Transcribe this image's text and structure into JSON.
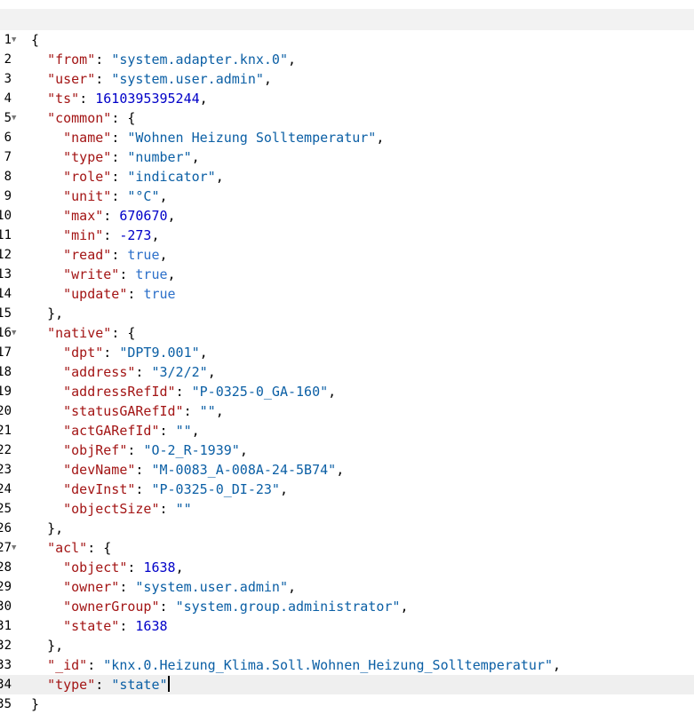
{
  "colors": {
    "key": "#a31515",
    "string": "#0b5fa5",
    "number": "#0000c8",
    "boolean": "#2b6fc9",
    "active_line": "#efefef",
    "topbar": "#f2f2f2"
  },
  "editor": {
    "lines": [
      {
        "num": "1",
        "fold": true,
        "indent": 0,
        "tokens": [
          {
            "t": "p",
            "v": "{"
          }
        ]
      },
      {
        "num": "2",
        "indent": 1,
        "tokens": [
          {
            "t": "k",
            "v": "\"from\""
          },
          {
            "t": "p",
            "v": ": "
          },
          {
            "t": "str",
            "v": "\"system.adapter.knx.0\""
          },
          {
            "t": "p",
            "v": ","
          }
        ]
      },
      {
        "num": "3",
        "indent": 1,
        "tokens": [
          {
            "t": "k",
            "v": "\"user\""
          },
          {
            "t": "p",
            "v": ": "
          },
          {
            "t": "str",
            "v": "\"system.user.admin\""
          },
          {
            "t": "p",
            "v": ","
          }
        ]
      },
      {
        "num": "4",
        "indent": 1,
        "tokens": [
          {
            "t": "k",
            "v": "\"ts\""
          },
          {
            "t": "p",
            "v": ": "
          },
          {
            "t": "n",
            "v": "1610395395244"
          },
          {
            "t": "p",
            "v": ","
          }
        ]
      },
      {
        "num": "5",
        "fold": true,
        "indent": 1,
        "tokens": [
          {
            "t": "k",
            "v": "\"common\""
          },
          {
            "t": "p",
            "v": ": {"
          }
        ]
      },
      {
        "num": "6",
        "indent": 2,
        "tokens": [
          {
            "t": "k",
            "v": "\"name\""
          },
          {
            "t": "p",
            "v": ": "
          },
          {
            "t": "str",
            "v": "\"Wohnen Heizung Solltemperatur\""
          },
          {
            "t": "p",
            "v": ","
          }
        ]
      },
      {
        "num": "7",
        "indent": 2,
        "tokens": [
          {
            "t": "k",
            "v": "\"type\""
          },
          {
            "t": "p",
            "v": ": "
          },
          {
            "t": "str",
            "v": "\"number\""
          },
          {
            "t": "p",
            "v": ","
          }
        ]
      },
      {
        "num": "8",
        "indent": 2,
        "tokens": [
          {
            "t": "k",
            "v": "\"role\""
          },
          {
            "t": "p",
            "v": ": "
          },
          {
            "t": "str",
            "v": "\"indicator\""
          },
          {
            "t": "p",
            "v": ","
          }
        ]
      },
      {
        "num": "9",
        "indent": 2,
        "tokens": [
          {
            "t": "k",
            "v": "\"unit\""
          },
          {
            "t": "p",
            "v": ": "
          },
          {
            "t": "str",
            "v": "\"°C\""
          },
          {
            "t": "p",
            "v": ","
          }
        ]
      },
      {
        "num": "10",
        "indent": 2,
        "tokens": [
          {
            "t": "k",
            "v": "\"max\""
          },
          {
            "t": "p",
            "v": ": "
          },
          {
            "t": "n",
            "v": "670670"
          },
          {
            "t": "p",
            "v": ","
          }
        ]
      },
      {
        "num": "11",
        "indent": 2,
        "tokens": [
          {
            "t": "k",
            "v": "\"min\""
          },
          {
            "t": "p",
            "v": ": "
          },
          {
            "t": "n",
            "v": "-273"
          },
          {
            "t": "p",
            "v": ","
          }
        ]
      },
      {
        "num": "12",
        "indent": 2,
        "tokens": [
          {
            "t": "k",
            "v": "\"read\""
          },
          {
            "t": "p",
            "v": ": "
          },
          {
            "t": "b",
            "v": "true"
          },
          {
            "t": "p",
            "v": ","
          }
        ]
      },
      {
        "num": "13",
        "indent": 2,
        "tokens": [
          {
            "t": "k",
            "v": "\"write\""
          },
          {
            "t": "p",
            "v": ": "
          },
          {
            "t": "b",
            "v": "true"
          },
          {
            "t": "p",
            "v": ","
          }
        ]
      },
      {
        "num": "14",
        "indent": 2,
        "tokens": [
          {
            "t": "k",
            "v": "\"update\""
          },
          {
            "t": "p",
            "v": ": "
          },
          {
            "t": "b",
            "v": "true"
          }
        ]
      },
      {
        "num": "15",
        "indent": 1,
        "tokens": [
          {
            "t": "p",
            "v": "},"
          }
        ]
      },
      {
        "num": "16",
        "fold": true,
        "indent": 1,
        "tokens": [
          {
            "t": "k",
            "v": "\"native\""
          },
          {
            "t": "p",
            "v": ": {"
          }
        ]
      },
      {
        "num": "17",
        "indent": 2,
        "tokens": [
          {
            "t": "k",
            "v": "\"dpt\""
          },
          {
            "t": "p",
            "v": ": "
          },
          {
            "t": "str",
            "v": "\"DPT9.001\""
          },
          {
            "t": "p",
            "v": ","
          }
        ]
      },
      {
        "num": "18",
        "indent": 2,
        "tokens": [
          {
            "t": "k",
            "v": "\"address\""
          },
          {
            "t": "p",
            "v": ": "
          },
          {
            "t": "str",
            "v": "\"3/2/2\""
          },
          {
            "t": "p",
            "v": ","
          }
        ]
      },
      {
        "num": "19",
        "indent": 2,
        "tokens": [
          {
            "t": "k",
            "v": "\"addressRefId\""
          },
          {
            "t": "p",
            "v": ": "
          },
          {
            "t": "str",
            "v": "\"P-0325-0_GA-160\""
          },
          {
            "t": "p",
            "v": ","
          }
        ]
      },
      {
        "num": "20",
        "indent": 2,
        "tokens": [
          {
            "t": "k",
            "v": "\"statusGARefId\""
          },
          {
            "t": "p",
            "v": ": "
          },
          {
            "t": "str",
            "v": "\"\""
          },
          {
            "t": "p",
            "v": ","
          }
        ]
      },
      {
        "num": "21",
        "indent": 2,
        "tokens": [
          {
            "t": "k",
            "v": "\"actGARefId\""
          },
          {
            "t": "p",
            "v": ": "
          },
          {
            "t": "str",
            "v": "\"\""
          },
          {
            "t": "p",
            "v": ","
          }
        ]
      },
      {
        "num": "22",
        "indent": 2,
        "tokens": [
          {
            "t": "k",
            "v": "\"objRef\""
          },
          {
            "t": "p",
            "v": ": "
          },
          {
            "t": "str",
            "v": "\"O-2_R-1939\""
          },
          {
            "t": "p",
            "v": ","
          }
        ]
      },
      {
        "num": "23",
        "indent": 2,
        "tokens": [
          {
            "t": "k",
            "v": "\"devName\""
          },
          {
            "t": "p",
            "v": ": "
          },
          {
            "t": "str",
            "v": "\"M-0083_A-008A-24-5B74\""
          },
          {
            "t": "p",
            "v": ","
          }
        ]
      },
      {
        "num": "24",
        "indent": 2,
        "tokens": [
          {
            "t": "k",
            "v": "\"devInst\""
          },
          {
            "t": "p",
            "v": ": "
          },
          {
            "t": "str",
            "v": "\"P-0325-0_DI-23\""
          },
          {
            "t": "p",
            "v": ","
          }
        ]
      },
      {
        "num": "25",
        "indent": 2,
        "tokens": [
          {
            "t": "k",
            "v": "\"objectSize\""
          },
          {
            "t": "p",
            "v": ": "
          },
          {
            "t": "str",
            "v": "\"\""
          }
        ]
      },
      {
        "num": "26",
        "indent": 1,
        "tokens": [
          {
            "t": "p",
            "v": "},"
          }
        ]
      },
      {
        "num": "27",
        "fold": true,
        "indent": 1,
        "tokens": [
          {
            "t": "k",
            "v": "\"acl\""
          },
          {
            "t": "p",
            "v": ": {"
          }
        ]
      },
      {
        "num": "28",
        "indent": 2,
        "tokens": [
          {
            "t": "k",
            "v": "\"object\""
          },
          {
            "t": "p",
            "v": ": "
          },
          {
            "t": "n",
            "v": "1638"
          },
          {
            "t": "p",
            "v": ","
          }
        ]
      },
      {
        "num": "29",
        "indent": 2,
        "tokens": [
          {
            "t": "k",
            "v": "\"owner\""
          },
          {
            "t": "p",
            "v": ": "
          },
          {
            "t": "str",
            "v": "\"system.user.admin\""
          },
          {
            "t": "p",
            "v": ","
          }
        ]
      },
      {
        "num": "30",
        "indent": 2,
        "tokens": [
          {
            "t": "k",
            "v": "\"ownerGroup\""
          },
          {
            "t": "p",
            "v": ": "
          },
          {
            "t": "str",
            "v": "\"system.group.administrator\""
          },
          {
            "t": "p",
            "v": ","
          }
        ]
      },
      {
        "num": "31",
        "indent": 2,
        "tokens": [
          {
            "t": "k",
            "v": "\"state\""
          },
          {
            "t": "p",
            "v": ": "
          },
          {
            "t": "n",
            "v": "1638"
          }
        ]
      },
      {
        "num": "32",
        "indent": 1,
        "tokens": [
          {
            "t": "p",
            "v": "},"
          }
        ]
      },
      {
        "num": "33",
        "indent": 1,
        "tokens": [
          {
            "t": "k",
            "v": "\"_id\""
          },
          {
            "t": "p",
            "v": ": "
          },
          {
            "t": "str",
            "v": "\"knx.0.Heizung_Klima.Soll.Wohnen_Heizung_Solltemperatur\""
          },
          {
            "t": "p",
            "v": ","
          }
        ]
      },
      {
        "num": "34",
        "active": true,
        "cursor": true,
        "indent": 1,
        "tokens": [
          {
            "t": "k",
            "v": "\"type\""
          },
          {
            "t": "p",
            "v": ": "
          },
          {
            "t": "str",
            "v": "\"state\""
          }
        ]
      },
      {
        "num": "35",
        "indent": 0,
        "tokens": [
          {
            "t": "p",
            "v": "}"
          }
        ]
      }
    ]
  }
}
